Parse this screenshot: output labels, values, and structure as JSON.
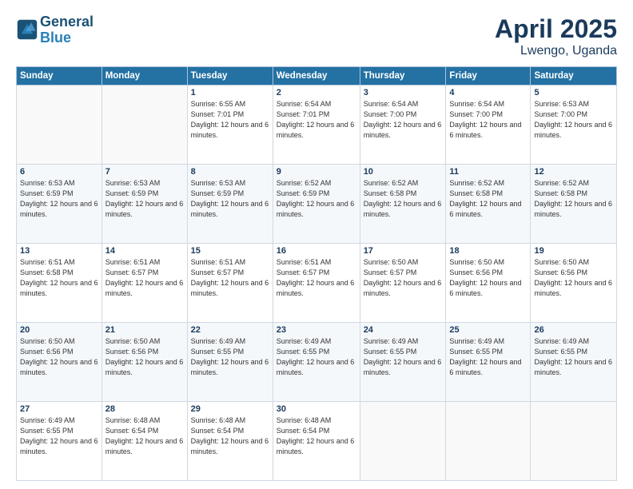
{
  "header": {
    "logo_line1": "General",
    "logo_line2": "Blue",
    "title": "April 2025",
    "location": "Lwengo, Uganda"
  },
  "days_of_week": [
    "Sunday",
    "Monday",
    "Tuesday",
    "Wednesday",
    "Thursday",
    "Friday",
    "Saturday"
  ],
  "weeks": [
    [
      {
        "day": "",
        "info": ""
      },
      {
        "day": "",
        "info": ""
      },
      {
        "day": "1",
        "info": "Sunrise: 6:55 AM\nSunset: 7:01 PM\nDaylight: 12 hours\nand 6 minutes."
      },
      {
        "day": "2",
        "info": "Sunrise: 6:54 AM\nSunset: 7:01 PM\nDaylight: 12 hours\nand 6 minutes."
      },
      {
        "day": "3",
        "info": "Sunrise: 6:54 AM\nSunset: 7:00 PM\nDaylight: 12 hours\nand 6 minutes."
      },
      {
        "day": "4",
        "info": "Sunrise: 6:54 AM\nSunset: 7:00 PM\nDaylight: 12 hours\nand 6 minutes."
      },
      {
        "day": "5",
        "info": "Sunrise: 6:53 AM\nSunset: 7:00 PM\nDaylight: 12 hours\nand 6 minutes."
      }
    ],
    [
      {
        "day": "6",
        "info": "Sunrise: 6:53 AM\nSunset: 6:59 PM\nDaylight: 12 hours\nand 6 minutes."
      },
      {
        "day": "7",
        "info": "Sunrise: 6:53 AM\nSunset: 6:59 PM\nDaylight: 12 hours\nand 6 minutes."
      },
      {
        "day": "8",
        "info": "Sunrise: 6:53 AM\nSunset: 6:59 PM\nDaylight: 12 hours\nand 6 minutes."
      },
      {
        "day": "9",
        "info": "Sunrise: 6:52 AM\nSunset: 6:59 PM\nDaylight: 12 hours\nand 6 minutes."
      },
      {
        "day": "10",
        "info": "Sunrise: 6:52 AM\nSunset: 6:58 PM\nDaylight: 12 hours\nand 6 minutes."
      },
      {
        "day": "11",
        "info": "Sunrise: 6:52 AM\nSunset: 6:58 PM\nDaylight: 12 hours\nand 6 minutes."
      },
      {
        "day": "12",
        "info": "Sunrise: 6:52 AM\nSunset: 6:58 PM\nDaylight: 12 hours\nand 6 minutes."
      }
    ],
    [
      {
        "day": "13",
        "info": "Sunrise: 6:51 AM\nSunset: 6:58 PM\nDaylight: 12 hours\nand 6 minutes."
      },
      {
        "day": "14",
        "info": "Sunrise: 6:51 AM\nSunset: 6:57 PM\nDaylight: 12 hours\nand 6 minutes."
      },
      {
        "day": "15",
        "info": "Sunrise: 6:51 AM\nSunset: 6:57 PM\nDaylight: 12 hours\nand 6 minutes."
      },
      {
        "day": "16",
        "info": "Sunrise: 6:51 AM\nSunset: 6:57 PM\nDaylight: 12 hours\nand 6 minutes."
      },
      {
        "day": "17",
        "info": "Sunrise: 6:50 AM\nSunset: 6:57 PM\nDaylight: 12 hours\nand 6 minutes."
      },
      {
        "day": "18",
        "info": "Sunrise: 6:50 AM\nSunset: 6:56 PM\nDaylight: 12 hours\nand 6 minutes."
      },
      {
        "day": "19",
        "info": "Sunrise: 6:50 AM\nSunset: 6:56 PM\nDaylight: 12 hours\nand 6 minutes."
      }
    ],
    [
      {
        "day": "20",
        "info": "Sunrise: 6:50 AM\nSunset: 6:56 PM\nDaylight: 12 hours\nand 6 minutes."
      },
      {
        "day": "21",
        "info": "Sunrise: 6:50 AM\nSunset: 6:56 PM\nDaylight: 12 hours\nand 6 minutes."
      },
      {
        "day": "22",
        "info": "Sunrise: 6:49 AM\nSunset: 6:55 PM\nDaylight: 12 hours\nand 6 minutes."
      },
      {
        "day": "23",
        "info": "Sunrise: 6:49 AM\nSunset: 6:55 PM\nDaylight: 12 hours\nand 6 minutes."
      },
      {
        "day": "24",
        "info": "Sunrise: 6:49 AM\nSunset: 6:55 PM\nDaylight: 12 hours\nand 6 minutes."
      },
      {
        "day": "25",
        "info": "Sunrise: 6:49 AM\nSunset: 6:55 PM\nDaylight: 12 hours\nand 6 minutes."
      },
      {
        "day": "26",
        "info": "Sunrise: 6:49 AM\nSunset: 6:55 PM\nDaylight: 12 hours\nand 6 minutes."
      }
    ],
    [
      {
        "day": "27",
        "info": "Sunrise: 6:49 AM\nSunset: 6:55 PM\nDaylight: 12 hours\nand 6 minutes."
      },
      {
        "day": "28",
        "info": "Sunrise: 6:48 AM\nSunset: 6:54 PM\nDaylight: 12 hours\nand 6 minutes."
      },
      {
        "day": "29",
        "info": "Sunrise: 6:48 AM\nSunset: 6:54 PM\nDaylight: 12 hours\nand 6 minutes."
      },
      {
        "day": "30",
        "info": "Sunrise: 6:48 AM\nSunset: 6:54 PM\nDaylight: 12 hours\nand 6 minutes."
      },
      {
        "day": "",
        "info": ""
      },
      {
        "day": "",
        "info": ""
      },
      {
        "day": "",
        "info": ""
      }
    ]
  ]
}
